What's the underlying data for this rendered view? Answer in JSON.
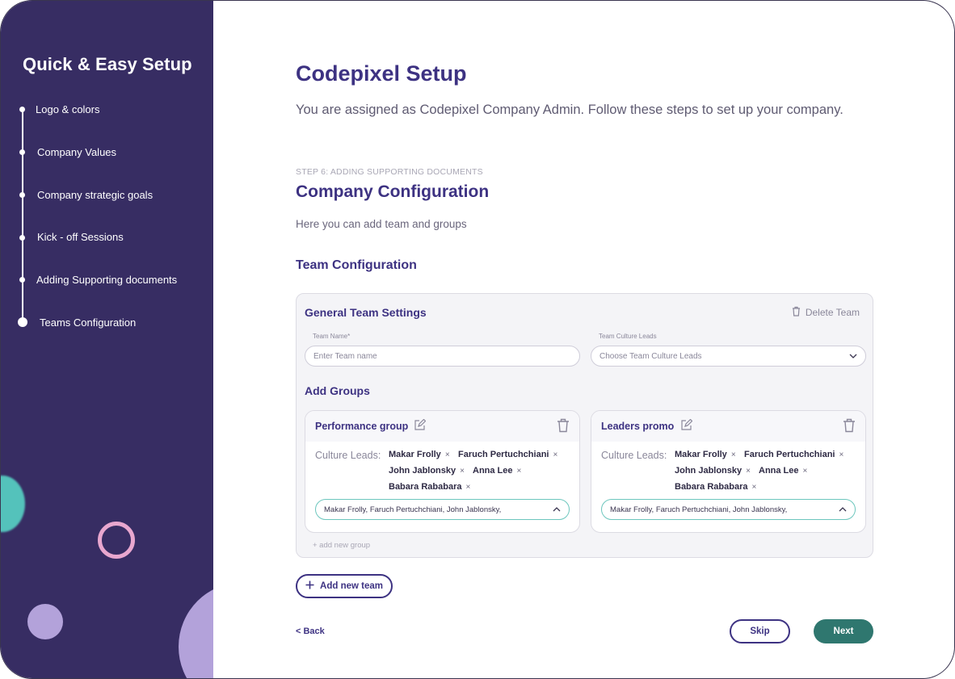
{
  "sidebar": {
    "title": "Quick & Easy Setup",
    "steps": [
      {
        "label": "Logo & colors"
      },
      {
        "label": "Company Values"
      },
      {
        "label": "Company strategic goals"
      },
      {
        "label": "Kick - off Sessions"
      },
      {
        "label": "Adding Supporting documents"
      },
      {
        "label": "Teams Configuration",
        "active": true
      }
    ]
  },
  "main": {
    "title": "Codepixel Setup",
    "subtitle": "You are assigned as Codepixel Company Admin. Follow these steps to set up your company.",
    "step_eyebrow": "STEP 6: ADDING SUPPORTING DOCUMENTS",
    "section_title": "Company Configuration",
    "section_sub": "Here you can add team and groups",
    "team_config_title": "Team Configuration"
  },
  "team_card": {
    "title": "General Team Settings",
    "delete_label": "Delete Team",
    "team_name_label": "Team Name*",
    "team_name_placeholder": "Enter Team name",
    "leads_label": "Team Culture Leads",
    "leads_placeholder": "Choose Team Culture Leads",
    "add_groups_label": "Add Groups",
    "add_group_link": "+ add new group",
    "groups": [
      {
        "name": "Performance  group",
        "culture_leads_label": "Culture Leads:",
        "leads": [
          "Makar Frolly",
          "Faruch Pertuchchiani",
          "John Jablonsky",
          "Anna Lee",
          "Babara Rababara"
        ],
        "select_value": "Makar Frolly, Faruch Pertuchchiani, John Jablonsky,"
      },
      {
        "name": "Leaders  promo",
        "culture_leads_label": "Culture Leads:",
        "leads": [
          "Makar Frolly",
          "Faruch Pertuchchiani",
          "John Jablonsky",
          "Anna Lee",
          "Babara Rababara"
        ],
        "select_value": "Makar Frolly, Faruch Pertuchchiani, John Jablonsky,"
      }
    ]
  },
  "actions": {
    "add_team": "Add new team",
    "back": "< Back",
    "skip": "Skip",
    "next": "Next"
  },
  "chip_remove_glyph": "×",
  "colors": {
    "sidebar_bg": "#372d63",
    "heading": "#3d3282",
    "primary_button": "#2f776f",
    "select_border": "#6cc6bd"
  }
}
